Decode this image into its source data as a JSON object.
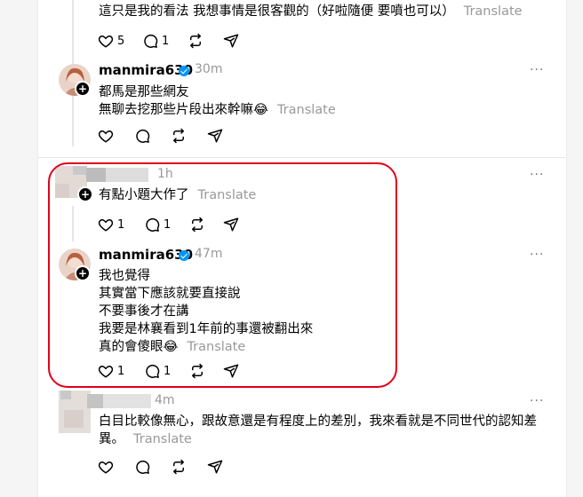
{
  "comments": [
    {
      "id": "c0",
      "text_lines": [
        "這只是我的看法 我想事情是很客觀的（好啦隨便 要噴也可以）"
      ],
      "translate": "Translate",
      "likes": "5",
      "replies": "1"
    },
    {
      "id": "c1",
      "username": "manmira630",
      "time": "30m",
      "text_lines": [
        "都馬是那些網友",
        "無聊去挖那些片段出來幹嘛😂"
      ],
      "translate": "Translate"
    },
    {
      "id": "c2",
      "time": "1h",
      "text_lines": [
        "有點小題大作了"
      ],
      "translate": "Translate",
      "likes": "1",
      "replies": "1"
    },
    {
      "id": "c3",
      "username": "manmira630",
      "time": "47m",
      "text_lines": [
        "我也覺得",
        "其實當下應該就要直接說",
        "不要事後才在講",
        "我要是林襄看到1年前的事還被翻出來",
        "真的會傻眼😂"
      ],
      "translate": "Translate",
      "likes": "1",
      "replies": "1"
    },
    {
      "id": "c4",
      "time": "4m",
      "text_lines": [
        "白目比較像無心，跟故意還是有程度上的差別，我來看就是不同世代的認知差",
        "異。"
      ],
      "translate": "Translate"
    }
  ],
  "more_label": "···"
}
